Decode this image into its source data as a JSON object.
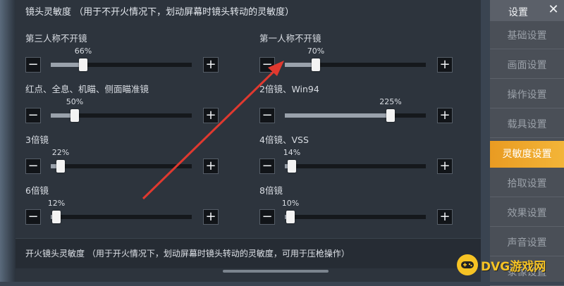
{
  "panel": {
    "section_title": "镜头灵敏度 （用于不开火情况下，划动屏幕时镜头转动的灵敏度）",
    "settings": [
      {
        "label": "第三人称不开镜",
        "value_text": "66%",
        "value": 0.23
      },
      {
        "label": "第一人称不开镜",
        "value_text": "70%",
        "value": 0.22
      },
      {
        "label": "红点、全息、机瞄、侧面瞄准镜",
        "value_text": "50%",
        "value": 0.17
      },
      {
        "label": "2倍镜、Win94",
        "value_text": "225%",
        "value": 0.75
      },
      {
        "label": "3倍镜",
        "value_text": "22%",
        "value": 0.07
      },
      {
        "label": "4倍镜、VSS",
        "value_text": "14%",
        "value": 0.05
      },
      {
        "label": "6倍镜",
        "value_text": "12%",
        "value": 0.04
      },
      {
        "label": "8倍镜",
        "value_text": "10%",
        "value": 0.04
      }
    ],
    "minus_symbol": "−",
    "plus_symbol": "+",
    "lower_section_title": "开火镜头灵敏度 （用于开火情况下，划动屏幕时镜头转动的灵敏度，可用于压枪操作）"
  },
  "sidebar": {
    "title": "设置",
    "close_symbol": "✕",
    "items": [
      "基础设置",
      "画面设置",
      "操作设置",
      "载具设置",
      "灵敏度设置",
      "拾取设置",
      "效果设置",
      "声音设置",
      "录像设置"
    ],
    "active_index": 4
  },
  "watermark": {
    "text": "DVG游戏网"
  },
  "colors": {
    "accent": "#f0a92e",
    "arrow": "#e0392f"
  }
}
